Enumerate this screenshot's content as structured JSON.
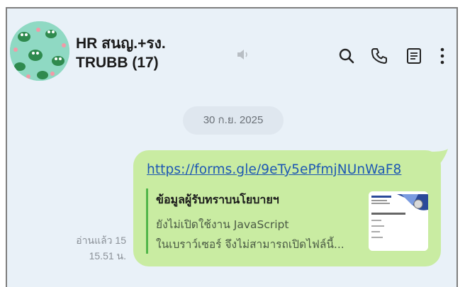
{
  "chat": {
    "title_line1": "HR สนญ.+รง.",
    "title_line2": "TRUBB (17)",
    "date": "30 ก.ย. 2025"
  },
  "header_icons": [
    "mute-icon",
    "search-icon",
    "phone-icon",
    "notes-icon",
    "more-icon"
  ],
  "message": {
    "link": "https://forms.gle/9eTy5ePfmjNUnWaF8",
    "preview_title": "ข้อมูลผู้รับทราบนโยบายฯ",
    "preview_line1": "ยังไม่เปิดใช้งาน JavaScript",
    "preview_line2": "ในเบราว์เซอร์ จึงไม่สามารถเปิดไฟล์นี้...",
    "read_status": "อ่านแล้ว 15",
    "time": "15.51 น."
  },
  "colors": {
    "background": "#e9f1f8",
    "bubble": "#c9eca2",
    "link": "#1e58b3",
    "preview_bar": "#52b64a",
    "date_pill": "#dfe7ef"
  }
}
